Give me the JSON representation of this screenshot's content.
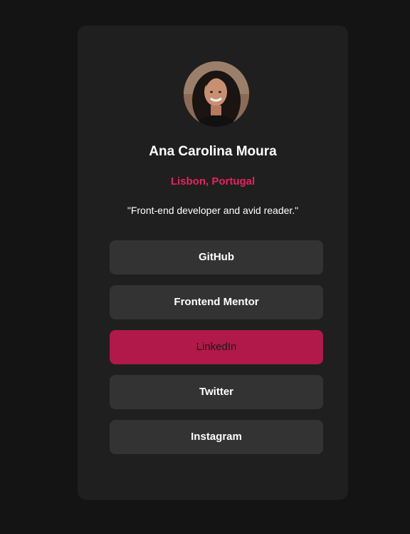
{
  "profile": {
    "name": "Ana Carolina Moura",
    "location": "Lisbon, Portugal",
    "bio": "\"Front-end developer and avid reader.\"",
    "avatar_alt": "avatar"
  },
  "links": [
    {
      "label": "GitHub",
      "active": false
    },
    {
      "label": "Frontend Mentor",
      "active": false
    },
    {
      "label": "LinkedIn",
      "active": true
    },
    {
      "label": "Twitter",
      "active": false
    },
    {
      "label": "Instagram",
      "active": false
    }
  ],
  "colors": {
    "background": "#141414",
    "card": "#1f1f1f",
    "button": "#333333",
    "accent": "#e3245f",
    "active_button": "#b0194a",
    "text": "#ffffff"
  }
}
